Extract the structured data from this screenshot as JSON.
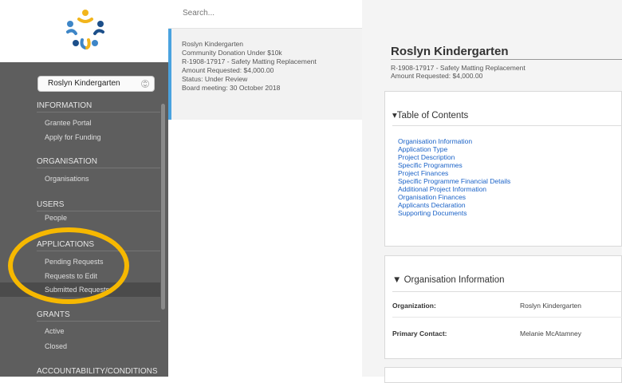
{
  "sidebar": {
    "org_selector": "Roslyn Kindergarten",
    "sections": [
      {
        "label": "INFORMATION",
        "items": [
          "Grantee Portal",
          "Apply for Funding"
        ]
      },
      {
        "label": "ORGANISATION",
        "items": [
          "Organisations"
        ]
      },
      {
        "label": "USERS",
        "items": [
          "People"
        ]
      },
      {
        "label": "APPLICATIONS",
        "items": [
          "Pending Requests",
          "Requests to Edit",
          "Submitted Requests"
        ]
      },
      {
        "label": "GRANTS",
        "items": [
          "Active",
          "Closed"
        ]
      },
      {
        "label": "ACCOUNTABILITY/CONDITIONS",
        "items": []
      }
    ],
    "active_item": "Submitted Requests",
    "highlight_color": "#f6b800"
  },
  "search": {
    "placeholder": "Search..."
  },
  "request_card": {
    "org": "Roslyn Kindergarten",
    "program": "Community Donation Under $10k",
    "ref": "R-1908-17917 - Safety Matting Replacement",
    "amount": "Amount Requested: $4,000.00",
    "status": "Status: Under Review",
    "meeting": "Board meeting: 30 October 2018",
    "accent_color": "#4aa3df"
  },
  "detail": {
    "title": "Roslyn Kindergarten",
    "ref": "R-1908-17917 - Safety Matting Replacement",
    "amount": "Amount Requested: $4,000.00",
    "toc_heading": "▾Table of Contents",
    "toc_links": [
      "Organisation Information",
      "Application Type",
      "Project Description",
      "Specific Programmes",
      "Project Finances",
      "Specific Programme Financial Details",
      "Additional Project Information",
      "Organisation Finances",
      "Applicants Declaration",
      "Supporting Documents"
    ],
    "org_heading": "▼ Organisation Information",
    "fields": [
      {
        "label": "Organization:",
        "value": "Roslyn Kindergarten"
      },
      {
        "label": "Primary Contact:",
        "value": "Melanie McAtamney"
      }
    ]
  }
}
